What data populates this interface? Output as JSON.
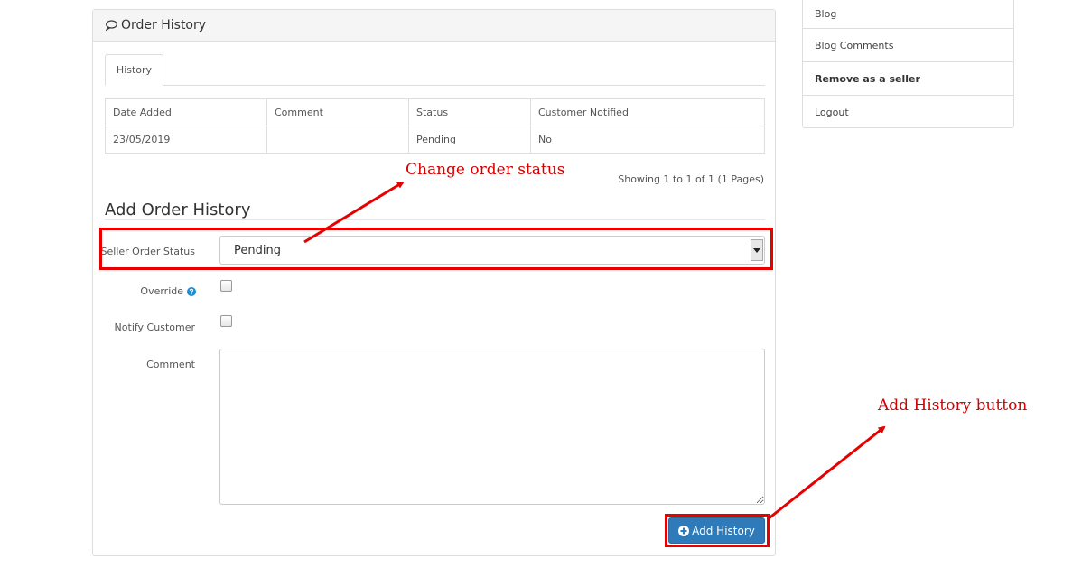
{
  "panel": {
    "title": "Order History",
    "title_icon": "speech-bubble-icon"
  },
  "tabs": [
    {
      "label": "History",
      "active": true
    }
  ],
  "history_table": {
    "columns": [
      "Date Added",
      "Comment",
      "Status",
      "Customer Notified"
    ],
    "rows": [
      [
        "23/05/2019",
        "",
        "Pending",
        "No"
      ]
    ]
  },
  "pagination_info": "Showing 1 to 1 of 1 (1 Pages)",
  "add_history": {
    "legend": "Add Order History",
    "status_label": "Seller Order Status",
    "status_value": "Pending",
    "override_label": "Override",
    "notify_label": "Notify Customer",
    "comment_label": "Comment",
    "comment_value": "",
    "button_label": "Add History",
    "button_icon": "plus-circle-icon"
  },
  "annotations": {
    "status": "Change order status",
    "button": "Add History button",
    "color": "#e60000"
  },
  "sidebar": {
    "items": [
      {
        "label": "Blog",
        "bold": false
      },
      {
        "label": "Blog Comments",
        "bold": false
      },
      {
        "label": "Remove as a seller",
        "bold": true
      },
      {
        "label": "Logout",
        "bold": false
      }
    ]
  },
  "colors": {
    "primary": "#2f7ab8",
    "help_icon": "#1a8fd0",
    "border": "#dddddd"
  }
}
